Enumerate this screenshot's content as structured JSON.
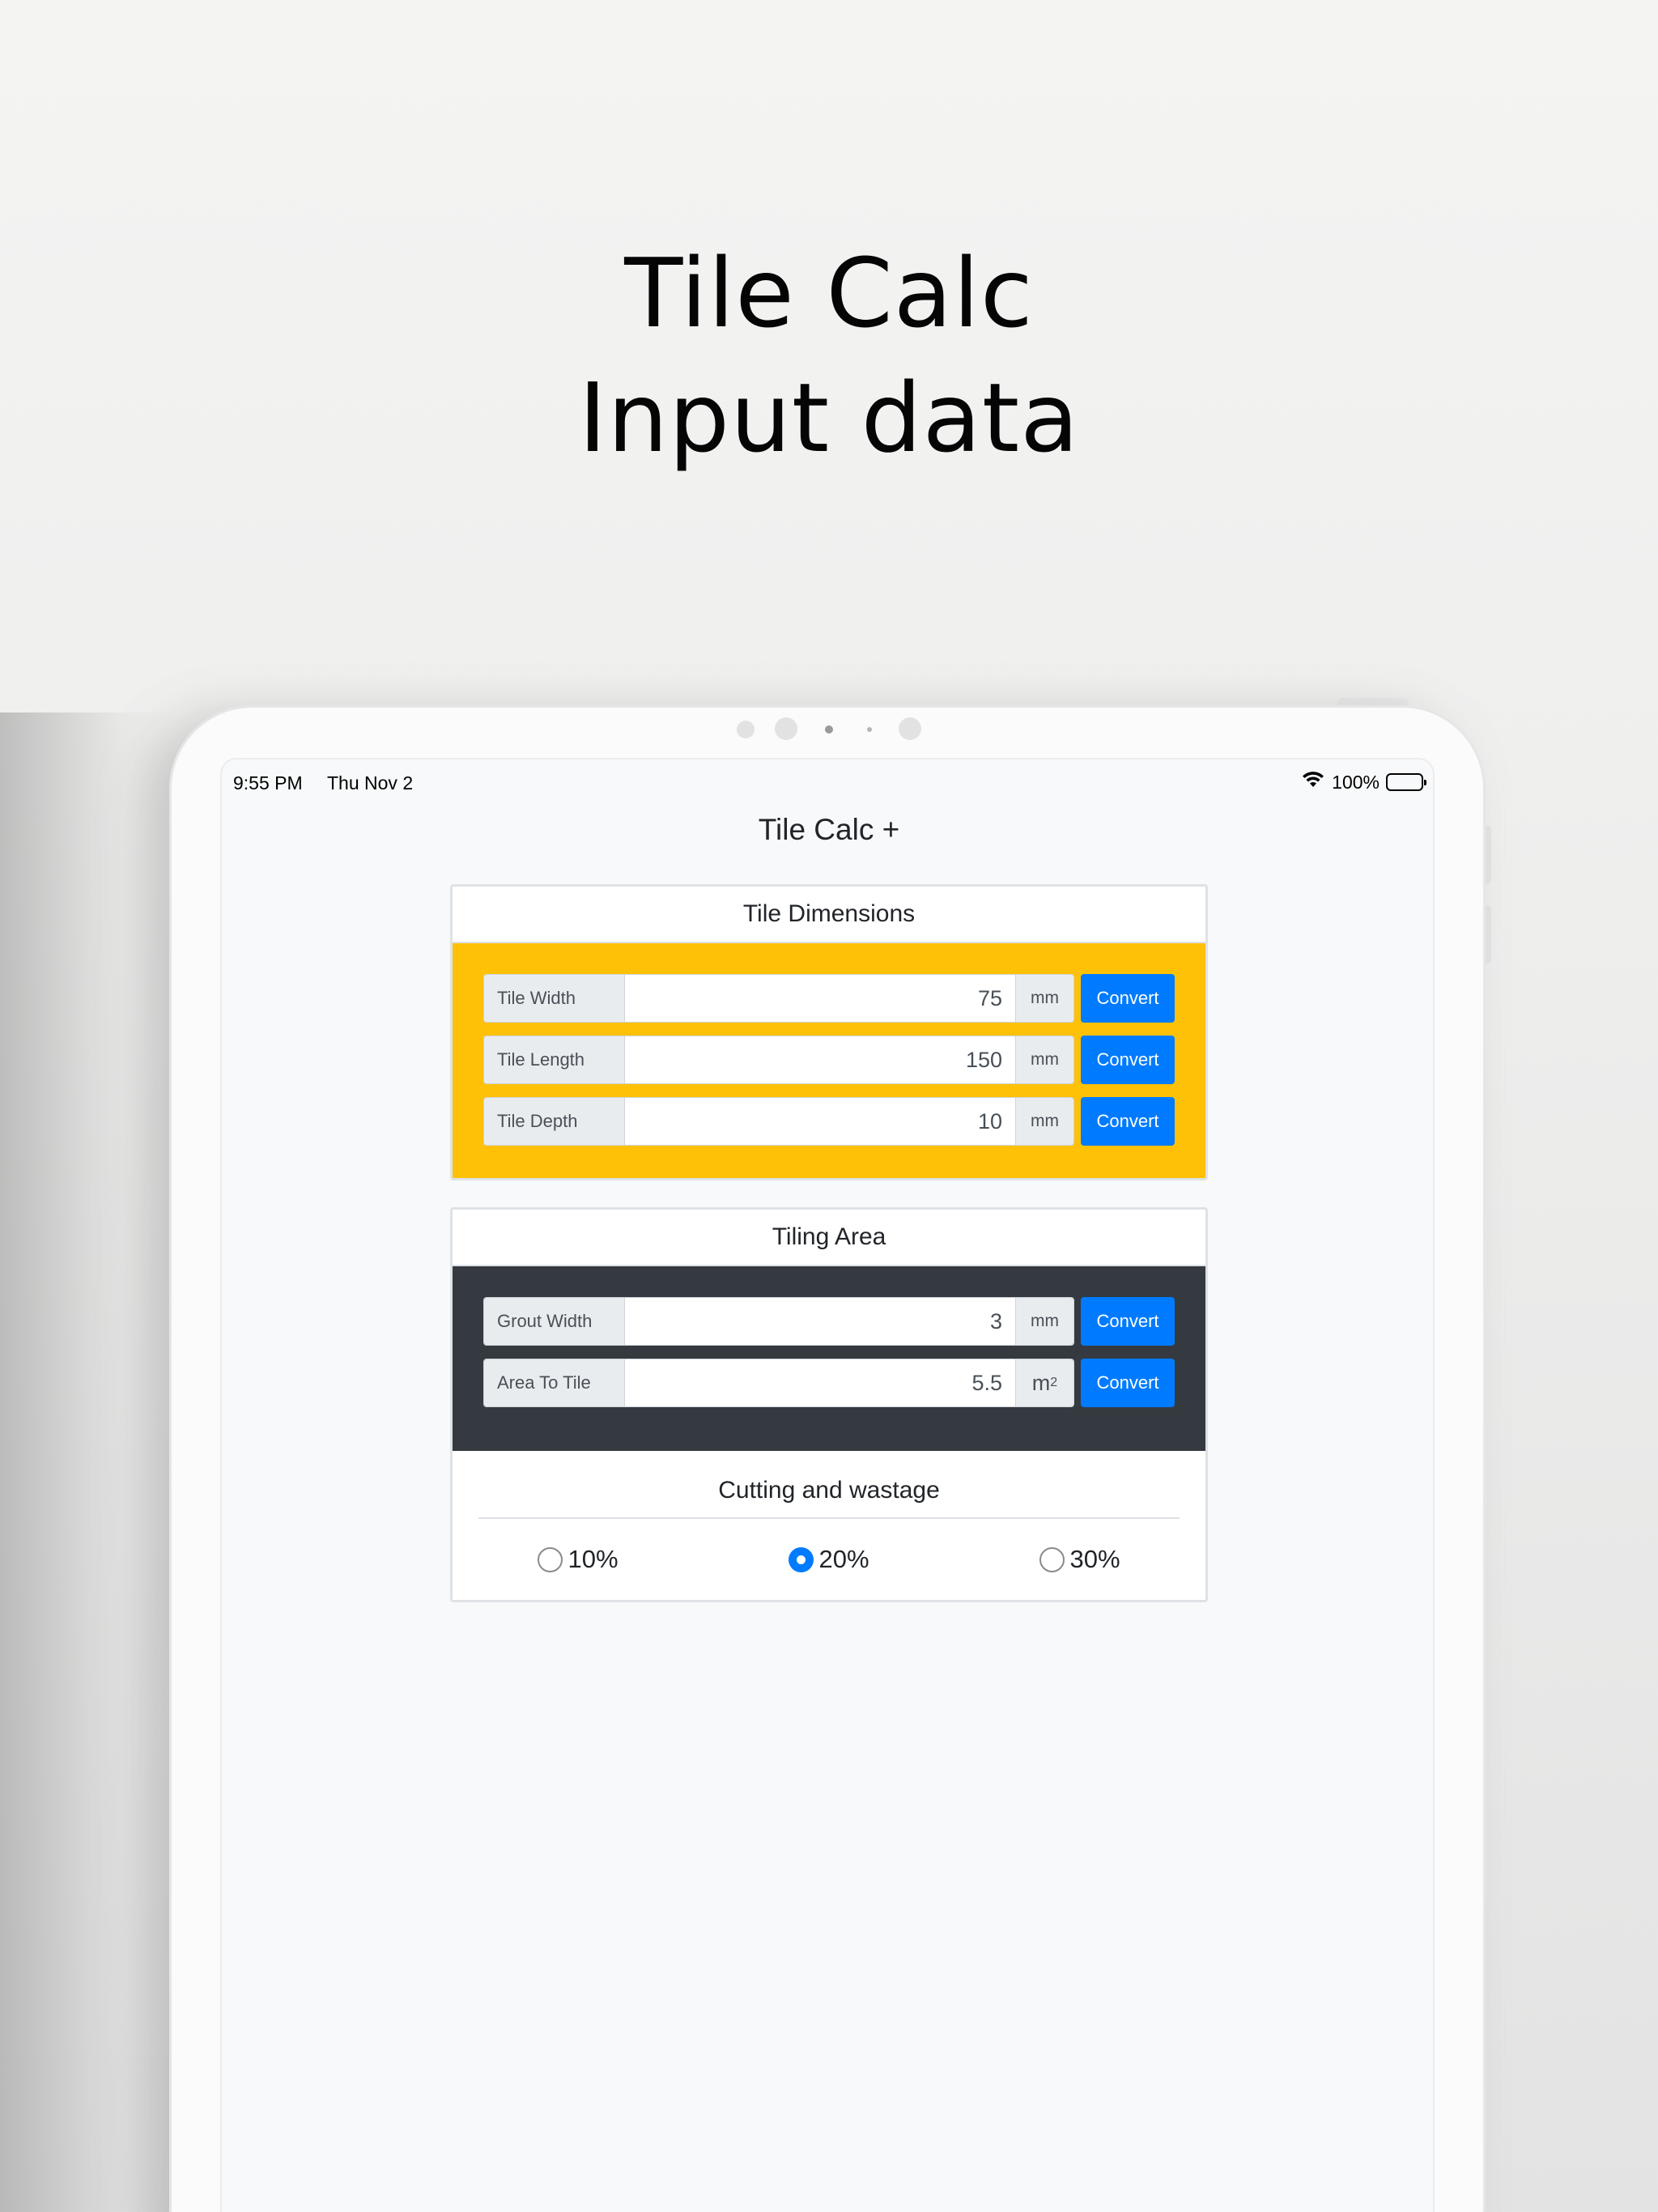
{
  "headline": {
    "line1": "Tile Calc",
    "line2": "Input data"
  },
  "status_bar": {
    "time": "9:55 PM",
    "date": "Thu Nov 2",
    "battery": "100%"
  },
  "app": {
    "title": "Tile Calc +"
  },
  "tile_dimensions": {
    "header": "Tile Dimensions",
    "rows": [
      {
        "label": "Tile Width",
        "value": "75",
        "unit": "mm",
        "button": "Convert"
      },
      {
        "label": "Tile Length",
        "value": "150",
        "unit": "mm",
        "button": "Convert"
      },
      {
        "label": "Tile Depth",
        "value": "10",
        "unit": "mm",
        "button": "Convert"
      }
    ]
  },
  "tiling_area": {
    "header": "Tiling Area",
    "rows": [
      {
        "label": "Grout Width",
        "value": "3",
        "unit": "mm",
        "button": "Convert"
      },
      {
        "label": "Area To Tile",
        "value": "5.5",
        "unit_base": "m",
        "unit_sup": "2",
        "button": "Convert"
      }
    ]
  },
  "wastage": {
    "title": "Cutting and wastage",
    "options": [
      {
        "label": "10%",
        "checked": false
      },
      {
        "label": "20%",
        "checked": true
      },
      {
        "label": "30%",
        "checked": false
      }
    ]
  },
  "colors": {
    "accent": "#007bff",
    "warning": "#ffc107",
    "dark": "#343a40"
  }
}
